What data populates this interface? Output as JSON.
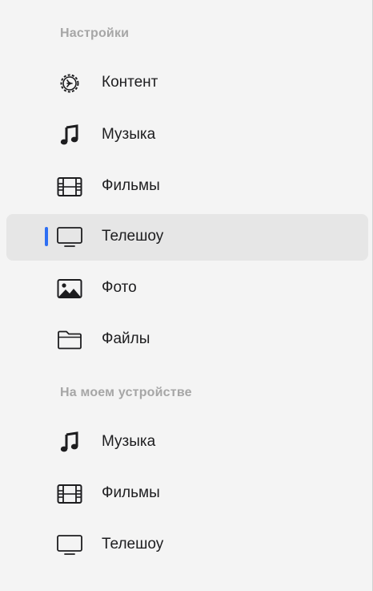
{
  "sidebar": {
    "settings_header": "Настройки",
    "settings_items": [
      {
        "label": "Контент",
        "icon": "gear-icon",
        "selected": false
      },
      {
        "label": "Музыка",
        "icon": "music-note-icon",
        "selected": false
      },
      {
        "label": "Фильмы",
        "icon": "film-icon",
        "selected": false
      },
      {
        "label": "Телешоу",
        "icon": "tv-icon",
        "selected": true
      },
      {
        "label": "Фото",
        "icon": "photo-icon",
        "selected": false
      },
      {
        "label": "Файлы",
        "icon": "folder-icon",
        "selected": false
      }
    ],
    "device_header": "На моем устройстве",
    "device_items": [
      {
        "label": "Музыка",
        "icon": "music-note-icon"
      },
      {
        "label": "Фильмы",
        "icon": "film-icon"
      },
      {
        "label": "Телешоу",
        "icon": "tv-icon"
      }
    ]
  },
  "colors": {
    "selection_indicator": "#2e6ff3",
    "selected_background": "#e6e6e6",
    "header_text": "#a6a6a6"
  }
}
